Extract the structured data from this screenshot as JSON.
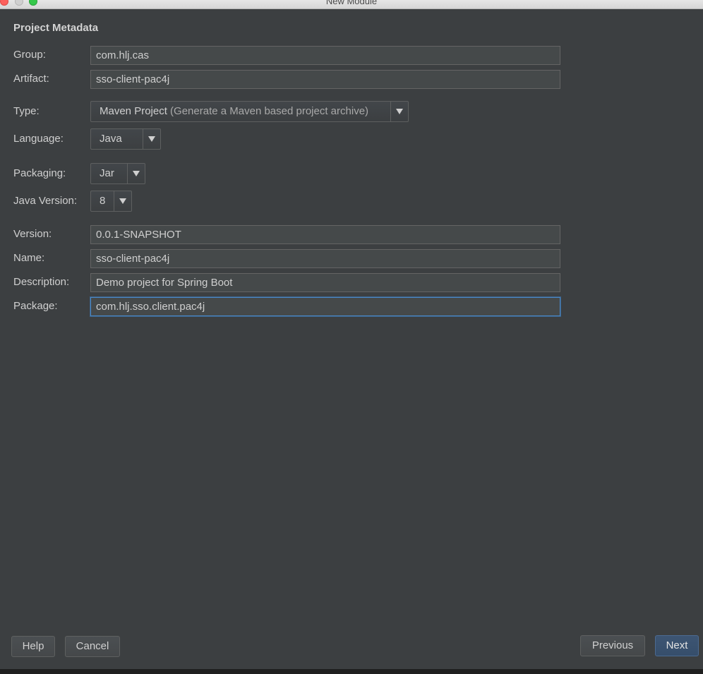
{
  "window": {
    "title": "New Module"
  },
  "section": {
    "title": "Project Metadata"
  },
  "fields": {
    "group": {
      "label": "Group:",
      "value": "com.hlj.cas"
    },
    "artifact": {
      "label": "Artifact:",
      "value": "sso-client-pac4j"
    },
    "type": {
      "label": "Type:",
      "value": "Maven Project",
      "hint": "(Generate a Maven based project archive)"
    },
    "language": {
      "label": "Language:",
      "value": "Java"
    },
    "packaging": {
      "label": "Packaging:",
      "value": "Jar"
    },
    "java_version": {
      "label": "Java Version:",
      "value": "8"
    },
    "version": {
      "label": "Version:",
      "value": "0.0.1-SNAPSHOT"
    },
    "name": {
      "label": "Name:",
      "value": "sso-client-pac4j"
    },
    "description": {
      "label": "Description:",
      "value": "Demo project for Spring Boot"
    },
    "package": {
      "label": "Package:",
      "value": "com.hlj.sso.client.pac4j"
    }
  },
  "buttons": {
    "help": "Help",
    "cancel": "Cancel",
    "previous": "Previous",
    "next": "Next"
  },
  "icons": {
    "dropdown": "triangle-down-icon",
    "window_close": "close-icon",
    "window_minimize": "minimize-icon",
    "window_maximize": "maximize-icon"
  },
  "colors": {
    "background": "#3c3f41",
    "field_bg": "#45494a",
    "focus_border": "#4a88c7",
    "primary_button": "#365880"
  }
}
